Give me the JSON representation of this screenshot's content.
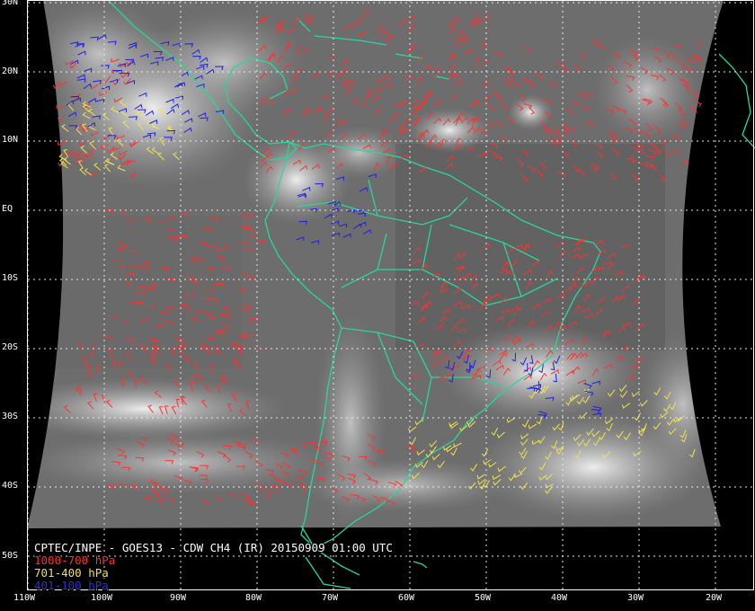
{
  "product": {
    "title": "CPTEC/INPE - GOES13 - CDW CH4 (IR) 20150909 01:00 UTC"
  },
  "legend": [
    {
      "label": "1000-700 hPa",
      "color": "#ff3030"
    },
    {
      "label": "701-400 hPa",
      "color": "#f2e24a"
    },
    {
      "label": "401-100 hPa",
      "color": "#2020e0"
    }
  ],
  "axes": {
    "lat_labels": [
      "30N",
      "20N",
      "10N",
      "EQ",
      "10S",
      "20S",
      "30S",
      "40S",
      "50S"
    ],
    "lon_labels": [
      "110W",
      "100W",
      "90W",
      "80W",
      "70W",
      "60W",
      "50W",
      "40W",
      "30W",
      "20W"
    ]
  },
  "colors": {
    "background": "#000000",
    "coastline": "#28d89a",
    "grid": "#e8e8e8",
    "axis_frame": "#ffffff"
  },
  "map_extent": {
    "lon_min": -110,
    "lon_max": -15,
    "lat_min": -53.3,
    "lat_max": 30
  },
  "wind_layers": [
    {
      "name": "low",
      "range": "1000-700 hPa",
      "color": "#ff3030",
      "regions": [
        [
          -100,
          -80,
          -20,
          0
        ],
        [
          -110,
          -95,
          5,
          22
        ],
        [
          -80,
          -50,
          5,
          28
        ],
        [
          -60,
          -30,
          -25,
          -5
        ],
        [
          -50,
          -20,
          5,
          25
        ],
        [
          -105,
          -80,
          -30,
          -20
        ],
        [
          -100,
          -60,
          -42,
          -32
        ]
      ]
    },
    {
      "name": "mid",
      "range": "701-400 hPa",
      "color": "#f2e24a",
      "regions": [
        [
          -110,
          -90,
          5,
          15
        ],
        [
          -60,
          -40,
          -40,
          -30
        ],
        [
          -45,
          -20,
          -35,
          -25
        ]
      ]
    },
    {
      "name": "high",
      "range": "401-100 hPa",
      "color": "#2020e0",
      "regions": [
        [
          -105,
          -85,
          10,
          25
        ],
        [
          -75,
          -65,
          -5,
          5
        ],
        [
          -55,
          -40,
          -25,
          -20
        ],
        [
          -45,
          -35,
          -30,
          -25
        ]
      ]
    }
  ]
}
